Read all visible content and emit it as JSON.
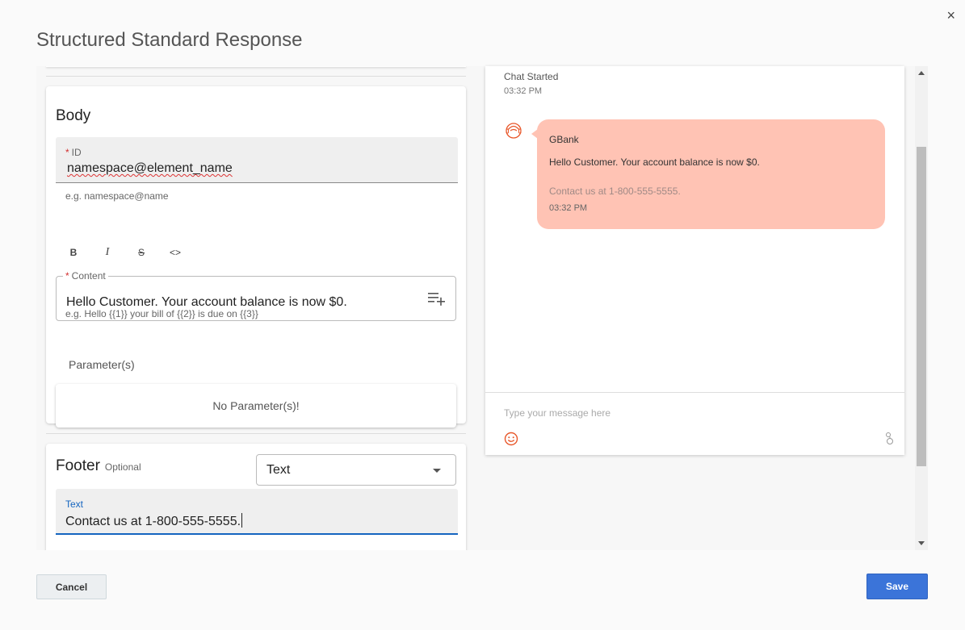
{
  "dialog": {
    "title": "Structured Standard Response",
    "close_label": "×"
  },
  "body_section": {
    "title": "Body",
    "id_field": {
      "required_mark": "*",
      "label": "ID",
      "value": "namespace@element_name",
      "hint": "e.g. namespace@name"
    },
    "toolbar": {
      "bold": "B",
      "italic": "I",
      "strike": "S",
      "code": "<>"
    },
    "content_field": {
      "required_mark": "*",
      "label": "Content",
      "value": "Hello Customer. Your account balance is now $0.",
      "hint": "e.g. Hello {{1}} your bill of {{2}} is due on {{3}}"
    },
    "parameters": {
      "label": "Parameter(s)",
      "empty_text": "No Parameter(s)!"
    }
  },
  "footer_section": {
    "title": "Footer",
    "optional_label": "Optional",
    "type_select": "Text",
    "text_field": {
      "label": "Text",
      "value": "Contact us at 1-800-555-5555."
    }
  },
  "preview": {
    "chat_started": "Chat Started",
    "started_time": "03:32 PM",
    "message": {
      "sender": "GBank",
      "text": "Hello Customer. Your account balance is now $0.",
      "footer": "Contact us at 1-800-555-5555.",
      "time": "03:32 PM"
    },
    "composer_placeholder": "Type your message here",
    "colors": {
      "bubble": "#ffc3b4",
      "accent": "#e8572a"
    }
  },
  "actions": {
    "cancel": "Cancel",
    "save": "Save",
    "save_color": "#3b74d9"
  }
}
